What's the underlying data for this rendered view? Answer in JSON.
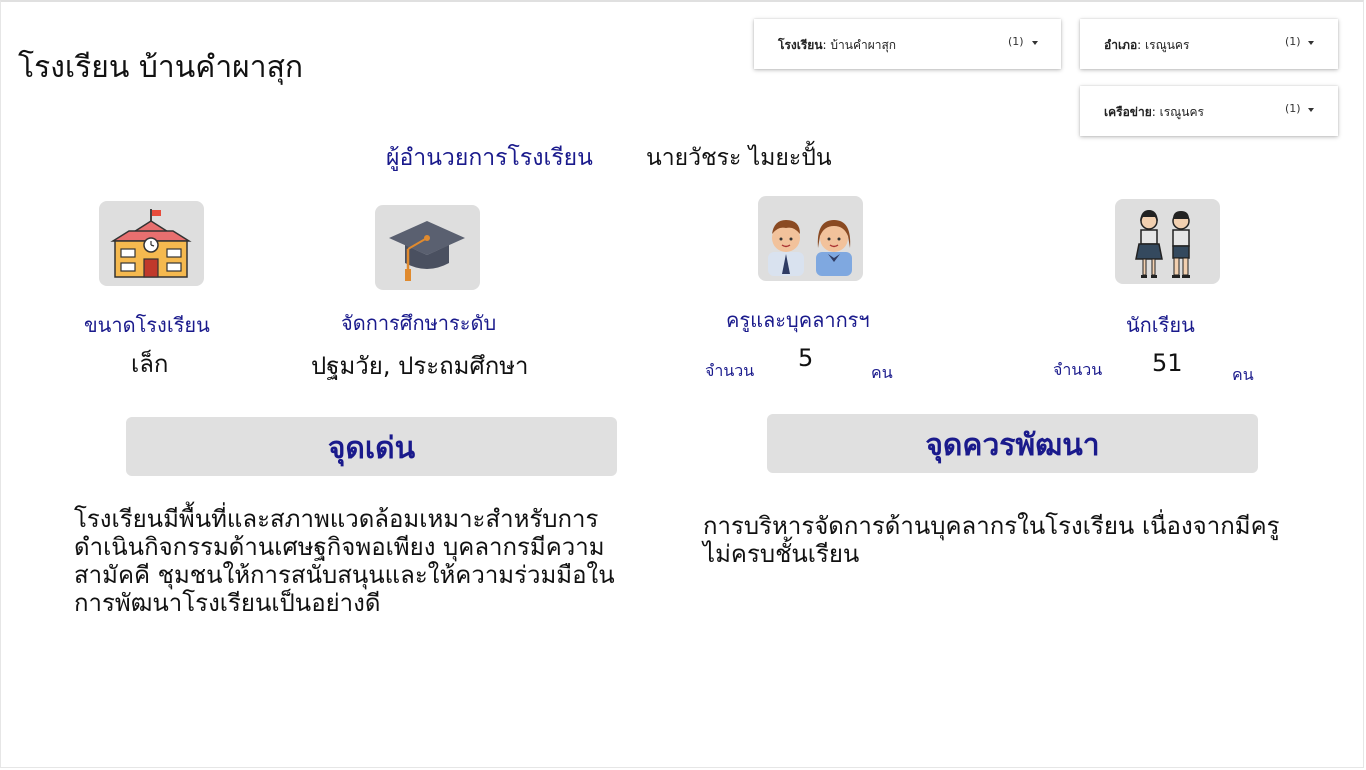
{
  "header": {
    "title": "โรงเรียน บ้านคำผาสุก"
  },
  "filters": [
    {
      "label": "โรงเรียน",
      "value": "บ้านคำผาสุก",
      "count": "(1)"
    },
    {
      "label": "อำเภอ",
      "value": "เรณูนคร",
      "count": "(1)"
    },
    {
      "label": "เครือข่าย",
      "value": "เรณูนคร",
      "count": "(1)"
    }
  ],
  "director": {
    "label": "ผู้อำนวยการโรงเรียน",
    "name": "นายวัชระ ไมยะปั้น"
  },
  "stats": {
    "size": {
      "label": "ขนาดโรงเรียน",
      "value": "เล็ก",
      "icon": "school-building-icon"
    },
    "level": {
      "label": "จัดการศึกษาระดับ",
      "value": "ปฐมวัย, ประถมศึกษา",
      "icon": "graduation-cap-icon"
    },
    "teachers": {
      "label": "ครูและบุคลากรฯ",
      "prefix": "จำนวน",
      "value": "5",
      "unit": "คน",
      "icon": "teachers-icon"
    },
    "students": {
      "label": "นักเรียน",
      "prefix": "จำนวน",
      "value": "51",
      "unit": "คน",
      "icon": "students-icon"
    }
  },
  "strengths": {
    "title": "จุดเด่น",
    "lines": [
      "โรงเรียนมีพื้นที่และสภาพแวดล้อมเหมาะสำหรับการ",
      "ดำเนินกิจกรรมด้านเศษฐกิจพอเพียง บุคลากรมีความ",
      "สามัคคี ชุมชนให้การสนับสนุนและให้ความร่วมมือใน",
      "การพัฒนาโรงเรียนเป็นอย่างดี"
    ]
  },
  "improvements": {
    "title": "จุดควรพัฒนา",
    "lines": [
      "การบริหารจัดการด้านบุคลากรในโรงเรียน เนื่องจากมีครู",
      "ไม่ครบชั้นเรียน"
    ]
  },
  "colors": {
    "accent_navy": "#1a1a8c",
    "panel_gray": "#e0e0e0"
  }
}
